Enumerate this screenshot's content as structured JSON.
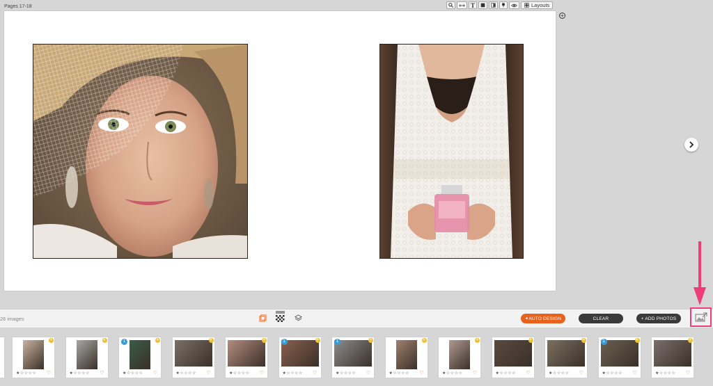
{
  "header": {
    "pages_label": "Pages 17-18"
  },
  "toolbar": {
    "items": [
      {
        "name": "zoom-tool-button",
        "glyph": "🔍"
      },
      {
        "name": "width-tool-button",
        "glyph": "↔"
      },
      {
        "name": "text-tool-button",
        "glyph": "T"
      },
      {
        "name": "frame-tool-button",
        "glyph": "▣"
      },
      {
        "name": "shape-tool-button",
        "glyph": "◑"
      },
      {
        "name": "pin-tool-button",
        "glyph": "⚑"
      },
      {
        "name": "preview-eye-button",
        "glyph": "👁"
      }
    ],
    "layouts_label": "Layouts"
  },
  "bottom_bar": {
    "image_count": "26 images",
    "auto_design": "✦AUTO DESIGN",
    "clear": "CLEAR",
    "add_photos": "+ ADD PHOTOS"
  },
  "thumbnails": [
    {
      "stars": "★☆☆☆☆",
      "heart": "♡",
      "color": "#c9b3a0",
      "portrait": true,
      "badge": ""
    },
    {
      "stars": "★☆☆☆☆",
      "heart": "♡",
      "color": "#a6a6a6",
      "portrait": true,
      "badge": ""
    },
    {
      "stars": "★☆☆☆☆",
      "heart": "♡",
      "color": "#3b5c48",
      "portrait": true,
      "badge": "1"
    },
    {
      "stars": "★☆☆☆☆",
      "heart": "♡",
      "color": "#7a7068",
      "portrait": false,
      "badge": ""
    },
    {
      "stars": "★☆☆☆☆",
      "heart": "♡",
      "color": "#b48c80",
      "portrait": false,
      "badge": ""
    },
    {
      "stars": "★☆☆☆☆",
      "heart": "♡",
      "color": "#8a6050",
      "portrait": false,
      "badge": "1"
    },
    {
      "stars": "★☆☆☆☆",
      "heart": "♡",
      "color": "#8c8c8c",
      "portrait": false,
      "badge": "1"
    },
    {
      "stars": "★☆☆☆☆",
      "heart": "♡",
      "color": "#a08070",
      "portrait": true,
      "badge": ""
    },
    {
      "stars": "★☆☆☆☆",
      "heart": "♡",
      "color": "#b09a90",
      "portrait": true,
      "badge": ""
    },
    {
      "stars": "★☆☆☆☆",
      "heart": "♡",
      "color": "#5a4a40",
      "portrait": false,
      "badge": ""
    },
    {
      "stars": "★☆☆☆☆",
      "heart": "♡",
      "color": "#7c7060",
      "portrait": false,
      "badge": ""
    },
    {
      "stars": "★☆☆☆☆",
      "heart": "♡",
      "color": "#6a6050",
      "portrait": false,
      "badge": "1"
    },
    {
      "stars": "★☆☆☆☆",
      "heart": "♡",
      "color": "#7a6e6a",
      "portrait": false,
      "badge": ""
    }
  ],
  "colors": {
    "accent": "#e8621e",
    "highlight": "#ef3d7b",
    "dark_button": "#3a3a3a"
  }
}
